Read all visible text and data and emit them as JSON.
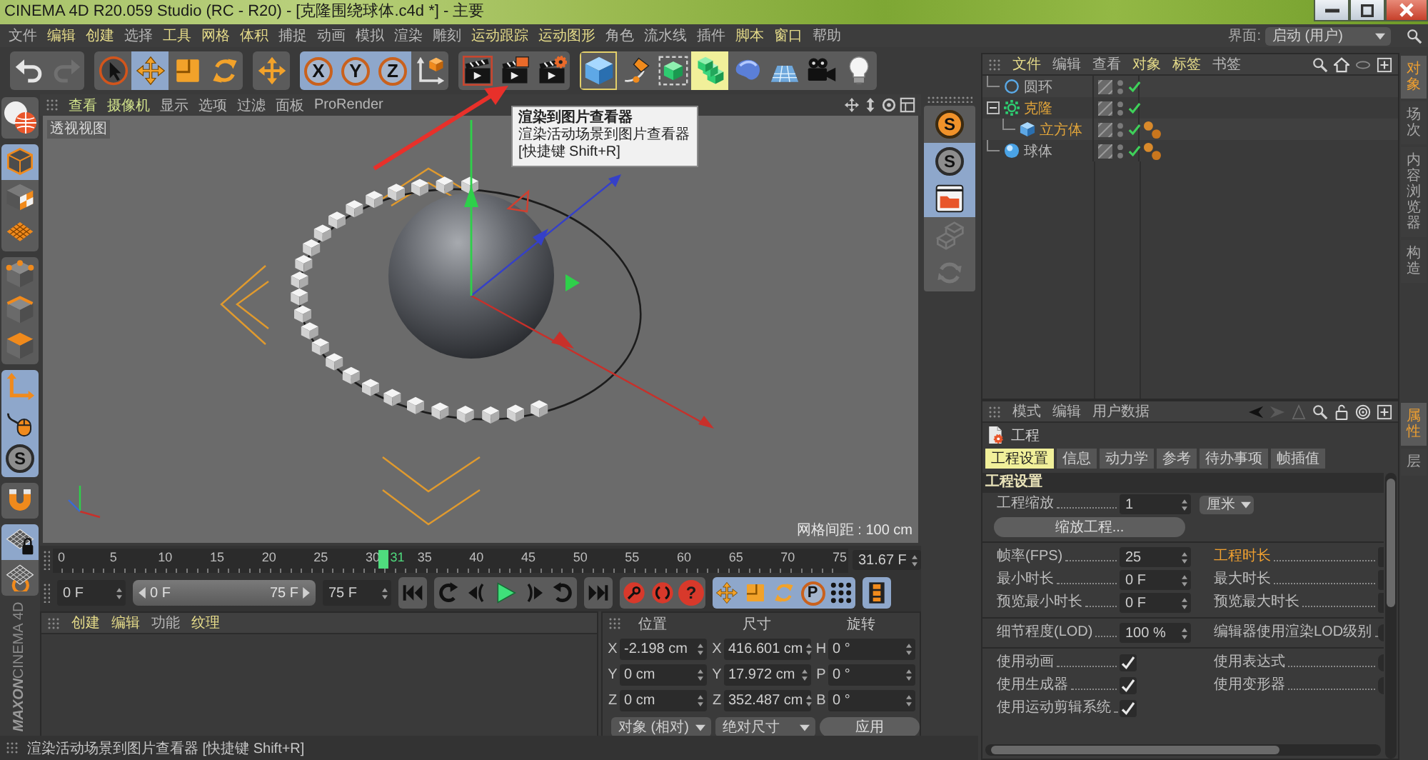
{
  "window": {
    "title": "CINEMA 4D R20.059 Studio (RC - R20) - [克隆围绕球体.c4d *] - 主要"
  },
  "menu_bar": {
    "items": [
      {
        "label": "文件",
        "highlighted": false
      },
      {
        "label": "编辑",
        "highlighted": true
      },
      {
        "label": "创建",
        "highlighted": true
      },
      {
        "label": "选择",
        "highlighted": false
      },
      {
        "label": "工具",
        "highlighted": true
      },
      {
        "label": "网格",
        "highlighted": true
      },
      {
        "label": "体积",
        "highlighted": true
      },
      {
        "label": "捕捉",
        "highlighted": false
      },
      {
        "label": "动画",
        "highlighted": false
      },
      {
        "label": "模拟",
        "highlighted": false
      },
      {
        "label": "渲染",
        "highlighted": false
      },
      {
        "label": "雕刻",
        "highlighted": false
      },
      {
        "label": "运动跟踪",
        "highlighted": true
      },
      {
        "label": "运动图形",
        "highlighted": true
      },
      {
        "label": "角色",
        "highlighted": false
      },
      {
        "label": "流水线",
        "highlighted": false
      },
      {
        "label": "插件",
        "highlighted": false
      },
      {
        "label": "脚本",
        "highlighted": true
      },
      {
        "label": "窗口",
        "highlighted": true
      },
      {
        "label": "帮助",
        "highlighted": false
      }
    ],
    "layout_label": "界面:",
    "layout_value": "启动 (用户)"
  },
  "toolbar": {
    "groups": [
      [
        {
          "kind": "undo",
          "selected": false
        },
        {
          "kind": "redo",
          "selected": false,
          "disabled": true
        }
      ],
      [
        {
          "kind": "select",
          "selected": false
        },
        {
          "kind": "move",
          "selected": true
        },
        {
          "kind": "scale",
          "selected": false
        },
        {
          "kind": "rotate",
          "selected": false
        }
      ],
      [
        {
          "kind": "transform",
          "selected": false
        }
      ],
      [
        {
          "kind": "axis",
          "label": "X",
          "selected": true
        },
        {
          "kind": "axis",
          "label": "Y",
          "selected": true
        },
        {
          "kind": "axis",
          "label": "Z",
          "selected": true
        },
        {
          "kind": "coords",
          "selected": false
        }
      ],
      [
        {
          "kind": "render-view",
          "selected": false
        },
        {
          "kind": "render-picture",
          "selected": false
        },
        {
          "kind": "render-settings",
          "selected": false
        }
      ],
      [
        {
          "kind": "cube",
          "selected": false,
          "focused": true
        },
        {
          "kind": "pen",
          "selected": false
        },
        {
          "kind": "subdivision",
          "selected": false
        },
        {
          "kind": "cloner",
          "selected": false,
          "highlighted": true
        },
        {
          "kind": "deformer",
          "selected": false
        },
        {
          "kind": "floor",
          "selected": false
        },
        {
          "kind": "camera",
          "selected": false
        },
        {
          "kind": "light",
          "selected": false
        }
      ]
    ]
  },
  "tooltip": {
    "title": "渲染到图片查看器",
    "description": "渲染活动场景到图片查看器",
    "shortcut": "[快捷键 Shift+R]"
  },
  "mode_toolbar": {
    "groups": [
      [
        {
          "kind": "editable",
          "selected": false
        }
      ],
      [
        {
          "kind": "model",
          "selected": true
        },
        {
          "kind": "texture",
          "selected": false
        },
        {
          "kind": "workplane",
          "selected": false
        }
      ],
      [
        {
          "kind": "points",
          "selected": false
        },
        {
          "kind": "edges",
          "selected": false
        },
        {
          "kind": "polygons",
          "selected": false
        }
      ],
      [
        {
          "kind": "axismode",
          "selected": true
        },
        {
          "kind": "tweak",
          "selected": true
        },
        {
          "kind": "solo",
          "label": "S",
          "selected": true
        }
      ],
      [
        {
          "kind": "magnet",
          "selected": false
        }
      ],
      [
        {
          "kind": "gridlock",
          "selected": true
        },
        {
          "kind": "grid",
          "selected": false
        }
      ]
    ]
  },
  "logo": {
    "brand": "MAXON",
    "product": "CINEMA 4D"
  },
  "viewport": {
    "menu": [
      {
        "label": "查看",
        "highlighted": true
      },
      {
        "label": "摄像机",
        "highlighted": true
      },
      {
        "label": "显示",
        "highlighted": false
      },
      {
        "label": "选项",
        "highlighted": false
      },
      {
        "label": "过滤",
        "highlighted": false
      },
      {
        "label": "面板",
        "highlighted": false
      },
      {
        "label": "ProRender",
        "highlighted": false
      }
    ],
    "view_name": "透视视图",
    "grid_spacing": "网格间距 : 100 cm"
  },
  "palette": {
    "items": [
      {
        "kind": "viewport-solo",
        "label": "S",
        "selected": false
      },
      {
        "kind": "solo",
        "label": "S",
        "selected": true
      },
      {
        "kind": "picture",
        "selected": true
      },
      {
        "kind": "frame",
        "selected": false,
        "disabled": true
      },
      {
        "kind": "gear",
        "selected": false,
        "disabled": true
      }
    ]
  },
  "timeline": {
    "ticks": [
      "0",
      "5",
      "10",
      "15",
      "20",
      "25",
      "30",
      "35",
      "40",
      "45",
      "50",
      "55",
      "60",
      "65",
      "70",
      "75"
    ],
    "playhead": {
      "label": "31",
      "level": 0.4133
    },
    "current": "31.67 F"
  },
  "transport": {
    "start": "0 F",
    "range": {
      "start": "0 F",
      "end": "75 F"
    },
    "end": "75 F",
    "groups": [
      [
        {
          "kind": "go-start",
          "selected": false
        }
      ],
      [
        {
          "kind": "prev-key",
          "selected": false
        },
        {
          "kind": "step-back",
          "selected": false
        },
        {
          "kind": "play",
          "selected": false
        },
        {
          "kind": "step-forward",
          "selected": false
        },
        {
          "kind": "next-key",
          "selected": false
        }
      ],
      [
        {
          "kind": "go-end",
          "selected": false
        }
      ],
      [
        {
          "kind": "record",
          "selected": false
        },
        {
          "kind": "auto-key",
          "selected": false
        },
        {
          "kind": "key-select",
          "label": "?",
          "selected": false
        }
      ],
      [
        {
          "kind": "key-move",
          "selected": true
        },
        {
          "kind": "key-scale",
          "selected": true
        },
        {
          "kind": "key-rotate",
          "selected": true
        },
        {
          "kind": "key-param",
          "label": "P",
          "selected": true
        },
        {
          "kind": "key-points",
          "selected": true
        }
      ],
      [
        {
          "kind": "timeline",
          "selected": true
        }
      ]
    ]
  },
  "material_manager": {
    "menu": [
      {
        "label": "创建",
        "highlighted": true
      },
      {
        "label": "编辑",
        "highlighted": true
      },
      {
        "label": "功能",
        "highlighted": false
      },
      {
        "label": "纹理",
        "highlighted": true
      }
    ]
  },
  "coordinates": {
    "columns": [
      "位置",
      "尺寸",
      "旋转"
    ],
    "rows": [
      [
        {
          "axis": "X",
          "value": "-2.198 cm"
        },
        {
          "axis": "X",
          "value": "416.601 cm"
        },
        {
          "axis": "H",
          "value": "0 °"
        }
      ],
      [
        {
          "axis": "Y",
          "value": "0 cm"
        },
        {
          "axis": "Y",
          "value": "17.972 cm"
        },
        {
          "axis": "P",
          "value": "0 °"
        }
      ],
      [
        {
          "axis": "Z",
          "value": "0 cm"
        },
        {
          "axis": "Z",
          "value": "352.487 cm"
        },
        {
          "axis": "B",
          "value": "0 °"
        }
      ]
    ],
    "mode_dropdowns": [
      "对象 (相对)",
      "绝对尺寸"
    ],
    "apply_button": "应用"
  },
  "status_bar": {
    "text": "渲染活动场景到图片查看器 [快捷键 Shift+R]"
  },
  "object_manager": {
    "menu": [
      {
        "label": "文件",
        "highlighted": true
      },
      {
        "label": "编辑",
        "highlighted": false
      },
      {
        "label": "查看",
        "highlighted": false
      },
      {
        "label": "对象",
        "highlighted": true
      },
      {
        "label": "标签",
        "highlighted": true
      },
      {
        "label": "书签",
        "highlighted": false
      }
    ],
    "objects": [
      {
        "name": "圆环",
        "kind": "circle",
        "selected": false,
        "enabled": true,
        "tag": false
      },
      {
        "name": "克隆",
        "kind": "cloner",
        "selected": true,
        "enabled": true,
        "tag": false,
        "expanded": true,
        "children": [
          {
            "name": "立方体",
            "kind": "cube",
            "selected": true,
            "enabled": true,
            "tag": true
          }
        ]
      },
      {
        "name": "球体",
        "kind": "sphere",
        "selected": false,
        "enabled": true,
        "tag": true
      }
    ]
  },
  "side_tabs_top": [
    {
      "label": "对象",
      "selected": true
    },
    {
      "label": "场次",
      "selected": false
    },
    {
      "label": "内容浏览器",
      "selected": false
    },
    {
      "label": "构造",
      "selected": false
    }
  ],
  "attributes": {
    "menu": [
      "模式",
      "编辑",
      "用户数据"
    ],
    "title": "工程",
    "tabs": [
      {
        "label": "工程设置",
        "selected": true
      },
      {
        "label": "信息",
        "selected": false
      },
      {
        "label": "动力学",
        "selected": false
      },
      {
        "label": "参考",
        "selected": false
      },
      {
        "label": "待办事项",
        "selected": false
      },
      {
        "label": "帧插值",
        "selected": false
      }
    ],
    "section": "工程设置",
    "scale": {
      "label": "工程缩放",
      "value": "1",
      "unit": "厘米"
    },
    "scale_button": "缩放工程...",
    "groups": [
      [
        {
          "left": {
            "kind": "number",
            "label": "帧率(FPS)",
            "value": "25",
            "highlighted": false
          },
          "right": {
            "kind": "number",
            "label": "工程时长",
            "highlighted": true
          }
        },
        {
          "left": {
            "kind": "number",
            "label": "最小时长",
            "value": "0 F",
            "highlighted": false
          },
          "right": {
            "kind": "number",
            "label": "最大时长",
            "highlighted": false
          }
        },
        {
          "left": {
            "kind": "number",
            "label": "预览最小时长",
            "value": "0 F",
            "highlighted": false
          },
          "right": {
            "kind": "number",
            "label": "预览最大时长",
            "highlighted": false
          }
        }
      ],
      [
        {
          "left": {
            "kind": "number",
            "label": "细节程度(LOD)",
            "value": "100 %",
            "highlighted": false
          },
          "right": {
            "kind": "check",
            "label": "编辑器使用渲染LOD级别",
            "highlighted": false
          }
        }
      ],
      [
        {
          "left": {
            "kind": "check",
            "label": "使用动画",
            "checked": true,
            "highlighted": false
          },
          "right": {
            "kind": "check",
            "label": "使用表达式",
            "highlighted": false
          }
        },
        {
          "left": {
            "kind": "check",
            "label": "使用生成器",
            "checked": true,
            "highlighted": false
          },
          "right": {
            "kind": "check",
            "label": "使用变形器",
            "highlighted": false
          }
        },
        {
          "left": {
            "kind": "check",
            "label": "使用运动剪辑系统",
            "checked": true,
            "highlighted": false
          }
        }
      ]
    ]
  },
  "side_tabs_bottom": [
    {
      "label": "属性",
      "selected": true
    },
    {
      "label": "层",
      "selected": false
    }
  ]
}
